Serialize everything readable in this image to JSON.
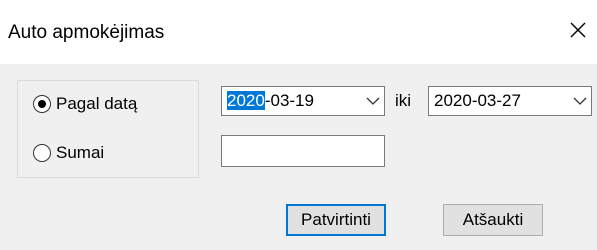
{
  "window": {
    "title": "Auto apmokėjimas",
    "close_icon": "close-icon"
  },
  "mode_group": {
    "options": [
      {
        "label": "Pagal datą",
        "checked": true
      },
      {
        "label": "Sumai",
        "checked": false
      }
    ]
  },
  "date_range": {
    "from": {
      "year_selected": "2020",
      "rest": "-03-19"
    },
    "separator": "iki",
    "to": "2020-03-27"
  },
  "amount_field": {
    "value": ""
  },
  "buttons": {
    "confirm": "Patvirtinti",
    "cancel": "Atšaukti"
  },
  "colors": {
    "accent": "#0078d7",
    "dialog_bg": "#f0f0f0",
    "button_bg": "#e1e1e1"
  }
}
